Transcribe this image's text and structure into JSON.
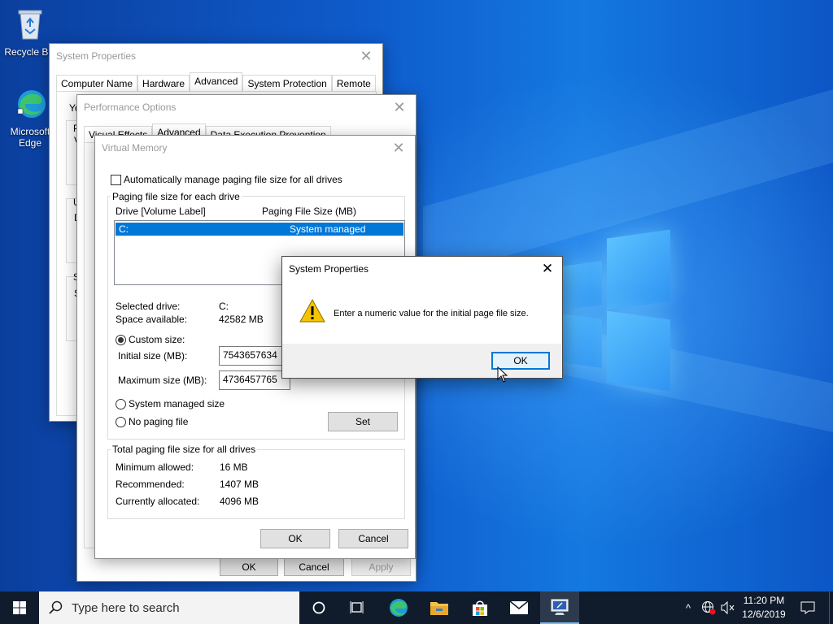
{
  "desktop": {
    "icons": [
      {
        "label": "Recycle Bin",
        "icon": "recycle-bin-icon"
      },
      {
        "label": "Microsoft Edge",
        "icon": "edge-icon"
      }
    ]
  },
  "system_properties": {
    "title": "System Properties",
    "tabs": [
      "Computer Name",
      "Hardware",
      "Advanced",
      "System Protection",
      "Remote"
    ],
    "selected_tab": "Advanced",
    "partial_text": {
      "y": "Yo",
      "p": "P",
      "v": "V",
      "u": "U",
      "d": "D",
      "s1": "S",
      "s2": "S"
    }
  },
  "performance_options": {
    "title": "Performance Options",
    "tabs": [
      "Visual Effects",
      "Advanced",
      "Data Execution Prevention"
    ],
    "selected_tab": "Advanced",
    "buttons": {
      "ok": "OK",
      "cancel": "Cancel",
      "apply": "Apply"
    }
  },
  "virtual_memory": {
    "title": "Virtual Memory",
    "auto_manage_label": "Automatically manage paging file size for all drives",
    "auto_manage_checked": false,
    "group_title": "Paging file size for each drive",
    "list_headers": {
      "drive": "Drive  [Volume Label]",
      "size": "Paging File Size (MB)"
    },
    "list_rows": [
      {
        "drive": "C:",
        "size": "System managed",
        "selected": true
      }
    ],
    "selected_drive_label": "Selected drive:",
    "selected_drive_value": "C:",
    "space_available_label": "Space available:",
    "space_available_value": "42582 MB",
    "custom_size_label": "Custom size:",
    "initial_size_label": "Initial size (MB):",
    "initial_size_value": "7543657634",
    "maximum_size_label": "Maximum size (MB):",
    "maximum_size_value": "4736457765",
    "system_managed_label": "System managed size",
    "no_paging_label": "No paging file",
    "selected_option": "Custom size",
    "set_button": "Set",
    "total_group_title": "Total paging file size for all drives",
    "minimum_label": "Minimum allowed:",
    "minimum_value": "16 MB",
    "recommended_label": "Recommended:",
    "recommended_value": "1407 MB",
    "allocated_label": "Currently allocated:",
    "allocated_value": "4096 MB",
    "ok_button": "OK",
    "cancel_button": "Cancel"
  },
  "message_box": {
    "title": "System Properties",
    "icon": "warning-icon",
    "message": "Enter a numeric value for the initial page file size.",
    "ok_button": "OK"
  },
  "taskbar": {
    "search_placeholder": "Type here to search",
    "apps": [
      "start-icon",
      "search-icon",
      "cortana-icon",
      "task-view-icon",
      "edge-icon",
      "file-explorer-icon",
      "store-icon",
      "mail-icon",
      "system-properties-icon"
    ],
    "time": "11:20 PM",
    "date": "12/6/2019"
  },
  "colors": {
    "accent": "#0078d7",
    "warning": "#f5c400",
    "taskbar": "#101c2c"
  }
}
